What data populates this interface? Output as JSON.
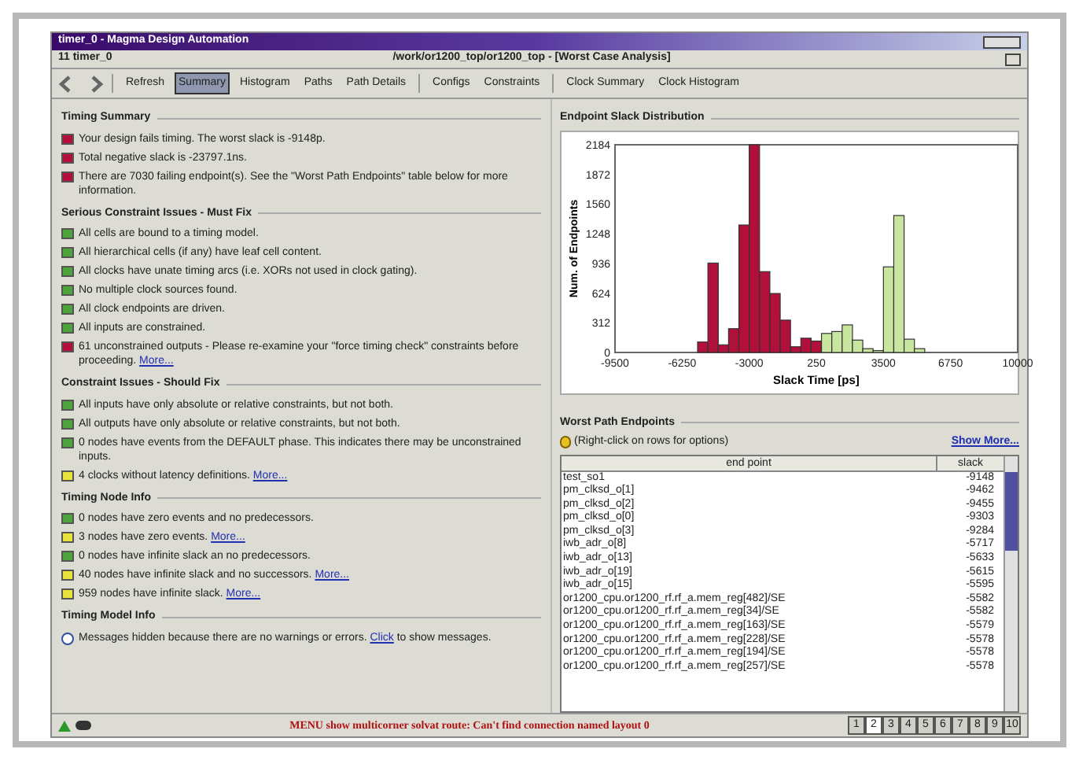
{
  "window": {
    "title": "timer_0 - Magma Design Automation",
    "document": "11 timer_0",
    "path": "/work/or1200_top/or1200_top - [Worst Case Analysis]"
  },
  "toolbar": [
    {
      "kind": "back"
    },
    {
      "kind": "forward"
    },
    {
      "kind": "sep"
    },
    {
      "kind": "tab",
      "label": "Refresh",
      "selected": false
    },
    {
      "kind": "tab",
      "label": "Summary",
      "selected": true
    },
    {
      "kind": "tab",
      "label": "Histogram",
      "selected": false
    },
    {
      "kind": "tab",
      "label": "Paths",
      "selected": false
    },
    {
      "kind": "tab",
      "label": "Path Details",
      "selected": false
    },
    {
      "kind": "sep"
    },
    {
      "kind": "tab",
      "label": "Configs",
      "selected": false
    },
    {
      "kind": "tab",
      "label": "Constraints",
      "selected": false
    },
    {
      "kind": "sep"
    },
    {
      "kind": "tab",
      "label": "Clock Summary",
      "selected": false
    },
    {
      "kind": "tab",
      "label": "Clock Histogram",
      "selected": false
    }
  ],
  "sections": [
    {
      "title": "Timing Summary",
      "items": [
        {
          "kind": "fail",
          "text": "Your design fails timing. The worst slack is -9148p."
        },
        {
          "kind": "fail",
          "text": "Total negative slack is -23797.1ns."
        },
        {
          "kind": "fail",
          "text": "There are 7030 failing endpoint(s). See the \"Worst Path Endpoints\" table below for more information."
        }
      ]
    },
    {
      "title": "Serious Constraint Issues - Must Fix",
      "items": [
        {
          "kind": "pass",
          "text": "All cells are bound to a timing model."
        },
        {
          "kind": "pass",
          "text": "All hierarchical cells (if any) have leaf cell content."
        },
        {
          "kind": "pass",
          "text": "All clocks have unate timing arcs (i.e. XORs not used in clock gating)."
        },
        {
          "kind": "pass",
          "text": "No multiple clock sources found."
        },
        {
          "kind": "pass",
          "text": "All clock endpoints are driven."
        },
        {
          "kind": "pass",
          "text": "All inputs are constrained."
        },
        {
          "kind": "fail",
          "text": "61 unconstrained outputs - Please re-examine your \"force timing check\" constraints before proceeding.",
          "link": "More..."
        }
      ]
    },
    {
      "title": "Constraint Issues - Should Fix",
      "items": [
        {
          "kind": "pass",
          "text": "All inputs have only absolute or relative constraints, but not both."
        },
        {
          "kind": "pass",
          "text": "All outputs have only absolute or relative constraints, but not both."
        },
        {
          "kind": "pass",
          "text": "0 nodes have events from the DEFAULT phase. This indicates there may be unconstrained inputs."
        },
        {
          "kind": "warn",
          "text": "4 clocks without latency definitions.",
          "link": "More..."
        }
      ]
    },
    {
      "title": "Timing Node Info",
      "items": [
        {
          "kind": "pass",
          "text": "0 nodes have zero events and no predecessors."
        },
        {
          "kind": "warn",
          "text": "3 nodes have zero events.",
          "link": "More..."
        },
        {
          "kind": "pass",
          "text": "0 nodes have infinite slack an no predecessors."
        },
        {
          "kind": "warn",
          "text": "40 nodes have infinite slack and no successors.",
          "link": "More..."
        },
        {
          "kind": "warn",
          "text": "959 nodes have infinite slack.",
          "link": "More..."
        }
      ]
    },
    {
      "title": "Timing Model Info",
      "items": [
        {
          "kind": "info",
          "text": "Messages hidden because there are no warnings or errors.",
          "link": "Click",
          "after": "to show messages."
        }
      ]
    }
  ],
  "histogram": {
    "title": "Endpoint Slack Distribution",
    "chart_data": {
      "type": "bar",
      "xlabel": "Slack Time [ps]",
      "ylabel": "Num. of Endpoints",
      "x": [
        -5250,
        -4750,
        -4250,
        -3750,
        -3250,
        -2750,
        -2250,
        -1750,
        -1250,
        -750,
        -250,
        250,
        750,
        1250,
        1750,
        2250,
        2750,
        3250,
        3750,
        4250,
        4750,
        5250
      ],
      "series": [
        {
          "color": "#b0103a",
          "values": [
            110,
            940,
            80,
            250,
            1340,
            2184,
            850,
            620,
            340,
            60,
            150,
            120,
            null,
            null,
            null,
            null,
            null,
            null,
            null,
            null,
            null,
            null
          ]
        },
        {
          "color": "#c8e6a0",
          "values": [
            null,
            null,
            null,
            null,
            null,
            null,
            null,
            null,
            null,
            null,
            null,
            null,
            200,
            220,
            290,
            130,
            40,
            20,
            900,
            1440,
            140,
            40
          ]
        }
      ],
      "xlim": [
        -9500,
        10000
      ],
      "ylim": [
        0,
        2184
      ],
      "xticks": [
        -9500,
        -6250,
        -3000,
        250,
        3500,
        6750,
        10000
      ],
      "yticks": [
        0,
        312,
        624,
        936,
        1248,
        1560,
        1872,
        2184
      ]
    }
  },
  "endpoints": {
    "title": "Worst Path Endpoints",
    "hint": "(Right-click on rows for options)",
    "show_more": "Show More...",
    "columns": [
      "end point",
      "slack"
    ],
    "rows": [
      [
        "test_so1",
        "-9148"
      ],
      [
        "pm_clksd_o[1]",
        "-9462"
      ],
      [
        "pm_clksd_o[2]",
        "-9455"
      ],
      [
        "pm_clksd_o[0]",
        "-9303"
      ],
      [
        "pm_clksd_o[3]",
        "-9284"
      ],
      [
        "iwb_adr_o[8]",
        "-5717"
      ],
      [
        "iwb_adr_o[13]",
        "-5633"
      ],
      [
        "iwb_adr_o[19]",
        "-5615"
      ],
      [
        "iwb_adr_o[15]",
        "-5595"
      ],
      [
        "or1200_cpu.or1200_rf.rf_a.mem_reg[482]/SE",
        "-5582"
      ],
      [
        "or1200_cpu.or1200_rf.rf_a.mem_reg[34]/SE",
        "-5582"
      ],
      [
        "or1200_cpu.or1200_rf.rf_a.mem_reg[163]/SE",
        "-5579"
      ],
      [
        "or1200_cpu.or1200_rf.rf_a.mem_reg[228]/SE",
        "-5578"
      ],
      [
        "or1200_cpu.or1200_rf.rf_a.mem_reg[194]/SE",
        "-5578"
      ],
      [
        "or1200_cpu.or1200_rf.rf_a.mem_reg[257]/SE",
        "-5578"
      ]
    ]
  },
  "status_bar": {
    "message": "MENU show multicorner solvat route: Can't find connection named layout 0",
    "pages": [
      {
        "label": "1",
        "selected": false
      },
      {
        "label": "2",
        "selected": true
      },
      {
        "label": "3",
        "selected": false
      },
      {
        "label": "4",
        "selected": false
      },
      {
        "label": "5",
        "selected": false
      },
      {
        "label": "6",
        "selected": false
      },
      {
        "label": "7",
        "selected": false
      },
      {
        "label": "8",
        "selected": false
      },
      {
        "label": "9",
        "selected": false
      },
      {
        "label": "10",
        "selected": false
      }
    ]
  }
}
